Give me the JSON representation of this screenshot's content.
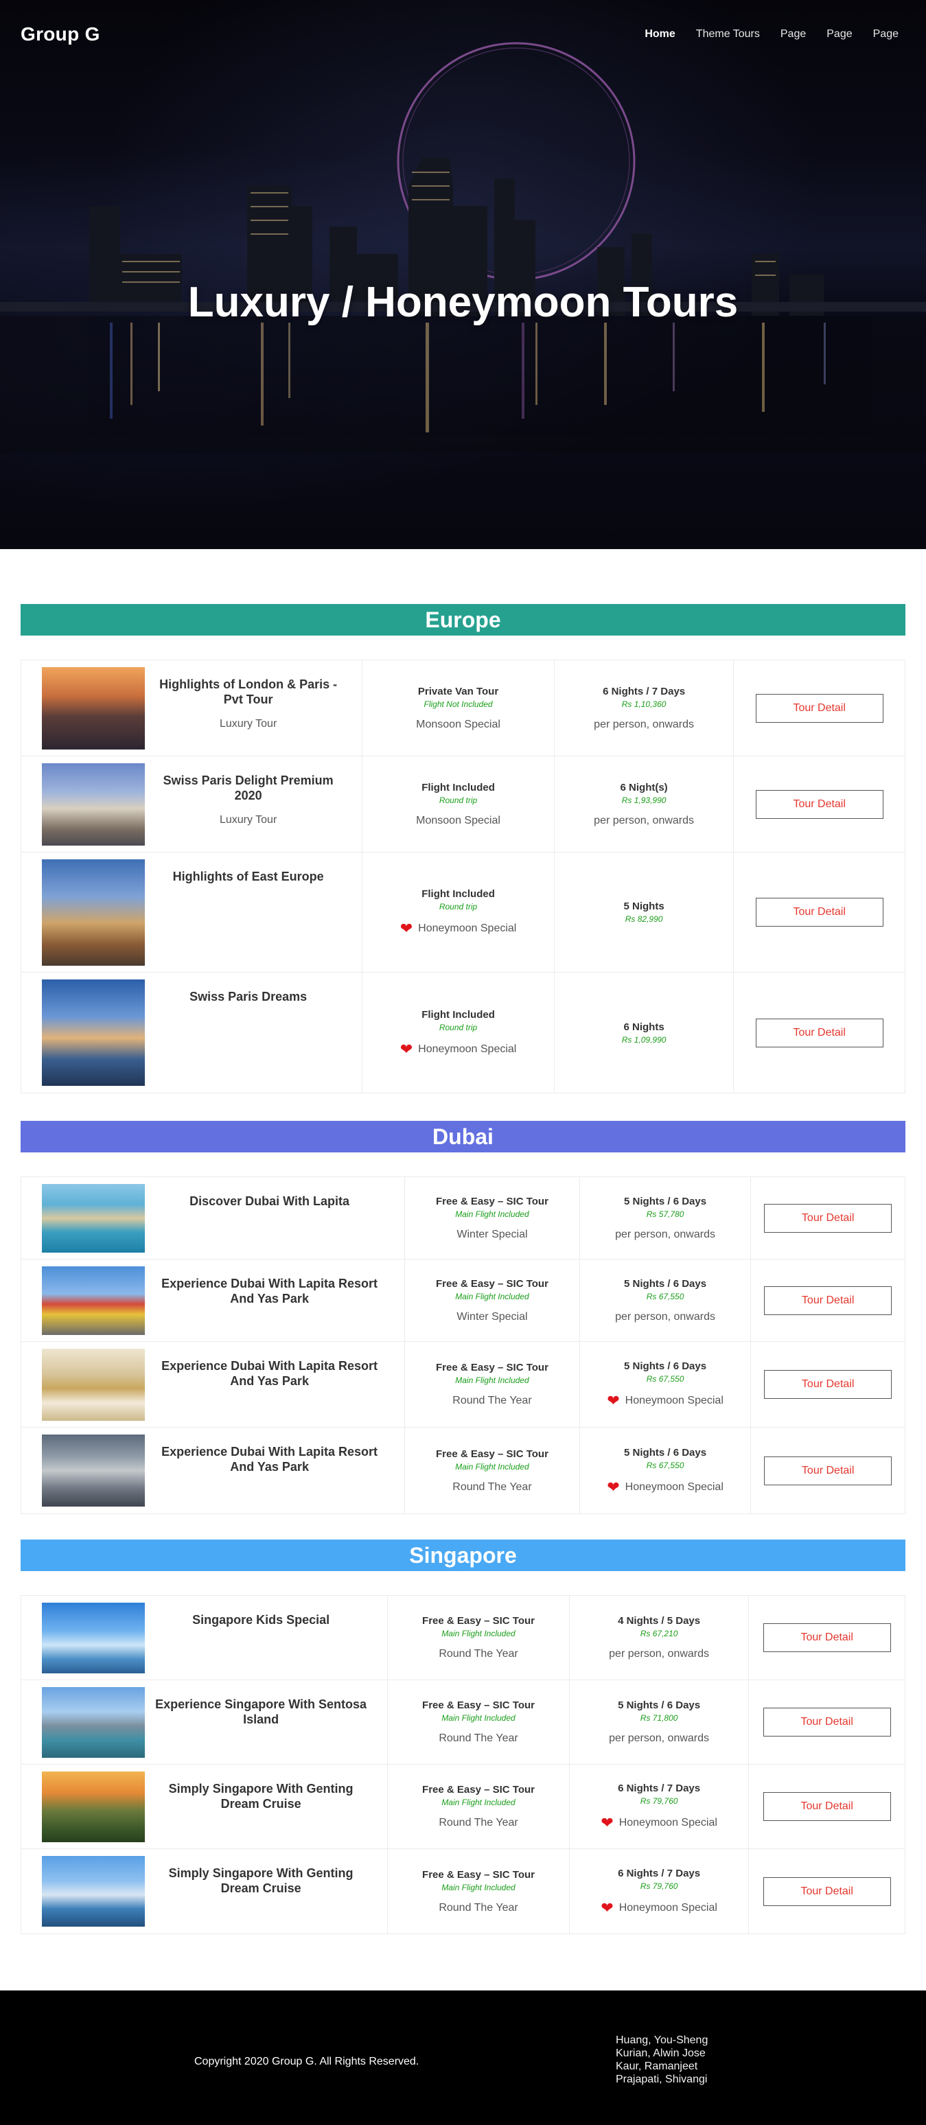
{
  "brand": "Group G",
  "nav": [
    {
      "label": "Home",
      "active": true
    },
    {
      "label": "Theme Tours",
      "active": false
    },
    {
      "label": "Page",
      "active": false
    },
    {
      "label": "Page",
      "active": false
    },
    {
      "label": "Page",
      "active": false
    }
  ],
  "hero_title": "Luxury / Honeymoon Tours",
  "button_label": "Tour Detail",
  "sections": [
    {
      "name": "Europe",
      "color": "#26a190",
      "rows": [
        {
          "name": "Highlights of London & Paris - Pvt Tour",
          "category": "Luxury Tour",
          "transport": "Private Van Tour",
          "transport_note": "Flight Not Included",
          "special": "Monsoon Special",
          "special_heart": false,
          "duration": "6 Nights / 7 Days",
          "price": "Rs 1,10,360",
          "price_note": "per person, onwards",
          "thumb": "castle"
        },
        {
          "name": "Swiss Paris Delight Premium 2020",
          "category": "Luxury Tour",
          "transport": "Flight Included",
          "transport_note": "Round trip",
          "special": "Monsoon Special",
          "special_heart": false,
          "duration": "6 Night(s)",
          "price": "Rs 1,93,990",
          "price_note": "per person, onwards",
          "thumb": "cathedral"
        },
        {
          "name": "Highlights of East Europe",
          "category": "",
          "transport": "Flight Included",
          "transport_note": "Round trip",
          "special": "Honeymoon Special",
          "special_heart": true,
          "duration": "5 Nights",
          "price": "Rs 82,990",
          "price_note": "",
          "thumb": "tower"
        },
        {
          "name": "Swiss Paris Dreams",
          "category": "",
          "transport": "Flight Included",
          "transport_note": "Round trip",
          "special": "Honeymoon Special",
          "special_heart": true,
          "duration": "6 Nights",
          "price": "Rs 1,09,990",
          "price_note": "",
          "thumb": "lake"
        }
      ]
    },
    {
      "name": "Dubai",
      "color": "#6370e0",
      "rows": [
        {
          "name": "Discover Dubai With Lapita",
          "category": "",
          "transport": "Free & Easy – SIC Tour",
          "transport_note": "Main Flight Included",
          "special": "Winter Special",
          "special_heart": false,
          "duration": "5 Nights / 6 Days",
          "price": "Rs 57,780",
          "price_note": "per person, onwards",
          "thumb": "palm"
        },
        {
          "name": "Experience Dubai With Lapita Resort And Yas Park",
          "category": "",
          "transport": "Free & Easy – SIC Tour",
          "transport_note": "Main Flight Included",
          "special": "Winter Special",
          "special_heart": false,
          "duration": "5 Nights / 6 Days",
          "price": "Rs 67,550",
          "price_note": "per person, onwards",
          "thumb": "legoland"
        },
        {
          "name": "Experience Dubai With Lapita Resort And Yas Park",
          "category": "",
          "transport": "Free & Easy – SIC Tour",
          "transport_note": "Main Flight Included",
          "special": "Round The Year",
          "special_heart": false,
          "duration": "5 Nights / 6 Days",
          "price": "Rs 67,550",
          "price_note": "Honeymoon Special",
          "price_heart": true,
          "thumb": "mosque"
        },
        {
          "name": "Experience Dubai With Lapita Resort And Yas Park",
          "category": "",
          "transport": "Free & Easy – SIC Tour",
          "transport_note": "Main Flight Included",
          "special": "Round The Year",
          "special_heart": false,
          "duration": "5 Nights / 6 Days",
          "price": "Rs 67,550",
          "price_note": "Honeymoon Special",
          "price_heart": true,
          "thumb": "aerial"
        }
      ]
    },
    {
      "name": "Singapore",
      "color": "#4aa9f4",
      "rows": [
        {
          "name": "Singapore Kids Special",
          "category": "",
          "transport": "Free & Easy – SIC Tour",
          "transport_note": "Main Flight Included",
          "special": "Round The Year",
          "special_heart": false,
          "duration": "4 Nights / 5 Days",
          "price": "Rs 67,210",
          "price_note": "per person, onwards",
          "thumb": "flyer"
        },
        {
          "name": "Experience Singapore With Sentosa Island",
          "category": "",
          "transport": "Free & Easy – SIC Tour",
          "transport_note": "Main Flight Included",
          "special": "Round The Year",
          "special_heart": false,
          "duration": "5 Nights / 6 Days",
          "price": "Rs 71,800",
          "price_note": "per person, onwards",
          "thumb": "skyline"
        },
        {
          "name": "Simply Singapore With Genting Dream Cruise",
          "category": "",
          "transport": "Free & Easy – SIC Tour",
          "transport_note": "Main Flight Included",
          "special": "Round The Year",
          "special_heart": false,
          "duration": "6 Nights / 7 Days",
          "price": "Rs 79,760",
          "price_note": "Honeymoon Special",
          "price_heart": true,
          "thumb": "sunset"
        },
        {
          "name": "Simply Singapore With Genting Dream Cruise",
          "category": "",
          "transport": "Free & Easy – SIC Tour",
          "transport_note": "Main Flight Included",
          "special": "Round The Year",
          "special_heart": false,
          "duration": "6 Nights / 7 Days",
          "price": "Rs 79,760",
          "price_note": "Honeymoon Special",
          "price_heart": true,
          "thumb": "mbs"
        }
      ]
    }
  ],
  "footer": {
    "copyright": "Copyright 2020 Group G. All Rights Reserved.",
    "authors": [
      "Huang, You-Sheng",
      "Kurian, Alwin Jose",
      "Kaur, Ramanjeet",
      "Prajapati, Shivangi"
    ]
  }
}
